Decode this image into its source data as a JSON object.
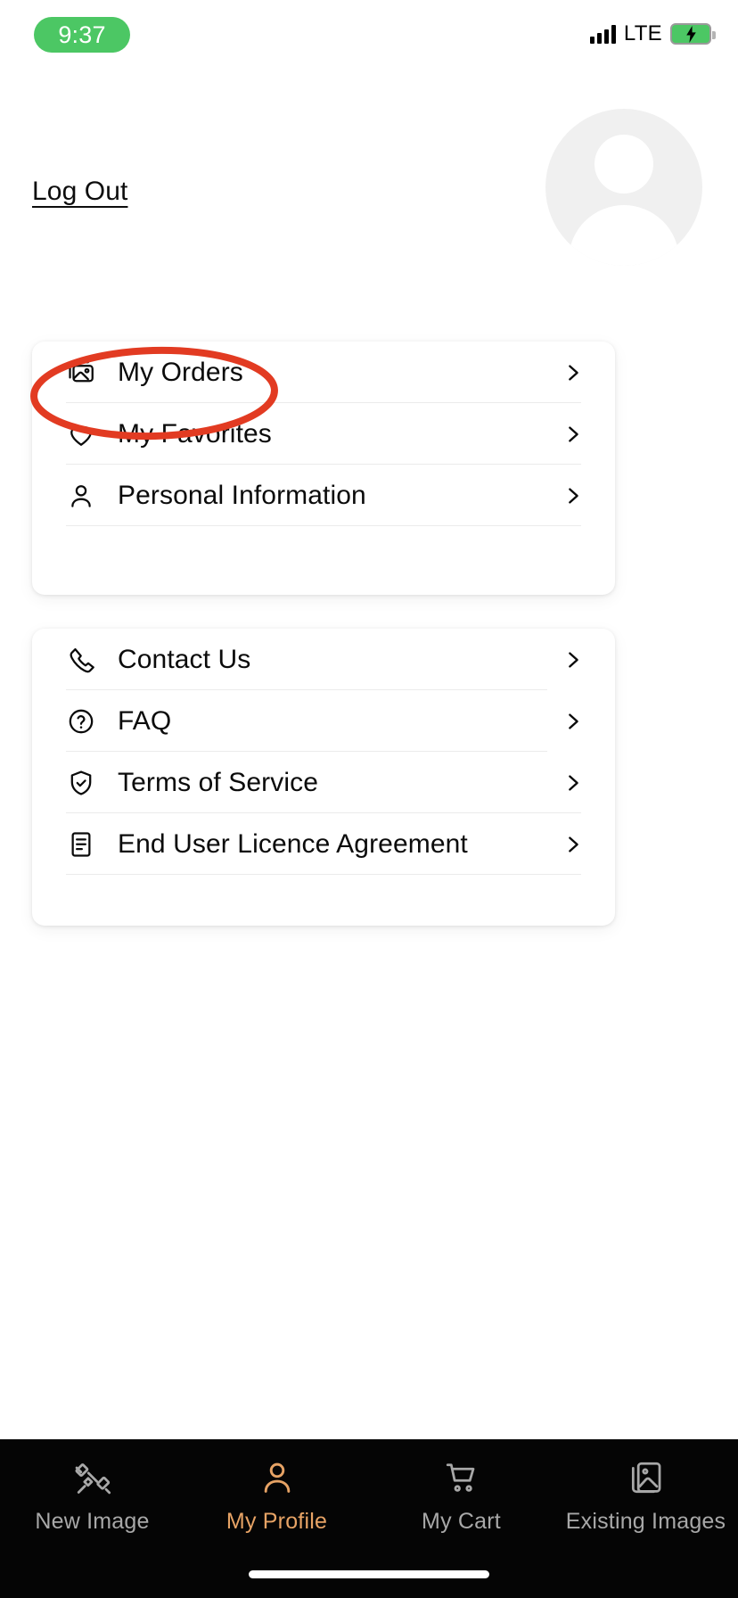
{
  "status_bar": {
    "time": "9:37",
    "network_label": "LTE",
    "time_pill_color": "#4CC764",
    "battery_color": "#4CC764",
    "battery_state": "charging",
    "signal_bars": 4
  },
  "header": {
    "logout_label": "Log Out",
    "avatar_alt": "user-avatar-placeholder"
  },
  "annotation": {
    "shape": "ellipse",
    "color": "#E23B22",
    "targets": "My Orders"
  },
  "account_card": {
    "items": [
      {
        "label": "My Orders",
        "icon": "images-stack-icon",
        "chevron": "chevron-right-icon"
      },
      {
        "label": "My Favorites",
        "icon": "heart-icon",
        "chevron": "chevron-right-icon"
      },
      {
        "label": "Personal Information",
        "icon": "person-icon",
        "chevron": "chevron-right-icon"
      }
    ]
  },
  "support_card": {
    "items": [
      {
        "label": "Contact Us",
        "icon": "phone-icon",
        "chevron": "chevron-right-icon"
      },
      {
        "label": "FAQ",
        "icon": "question-circle-icon",
        "chevron": "chevron-right-icon"
      },
      {
        "label": "Terms of Service",
        "icon": "shield-check-icon",
        "chevron": "chevron-right-icon"
      },
      {
        "label": "End User Licence Agreement",
        "icon": "document-icon",
        "chevron": "chevron-right-icon"
      }
    ]
  },
  "tabbar": {
    "active_color": "#E7A365",
    "inactive_color": "#A8A8A8",
    "background": "#050505",
    "tabs": [
      {
        "label": "New Image",
        "icon": "satellite-icon",
        "active": false
      },
      {
        "label": "My Profile",
        "icon": "person-icon",
        "active": true
      },
      {
        "label": "My Cart",
        "icon": "shopping-cart-icon",
        "active": false
      },
      {
        "label": "Existing Images",
        "icon": "images-stack-icon",
        "active": false
      }
    ]
  }
}
